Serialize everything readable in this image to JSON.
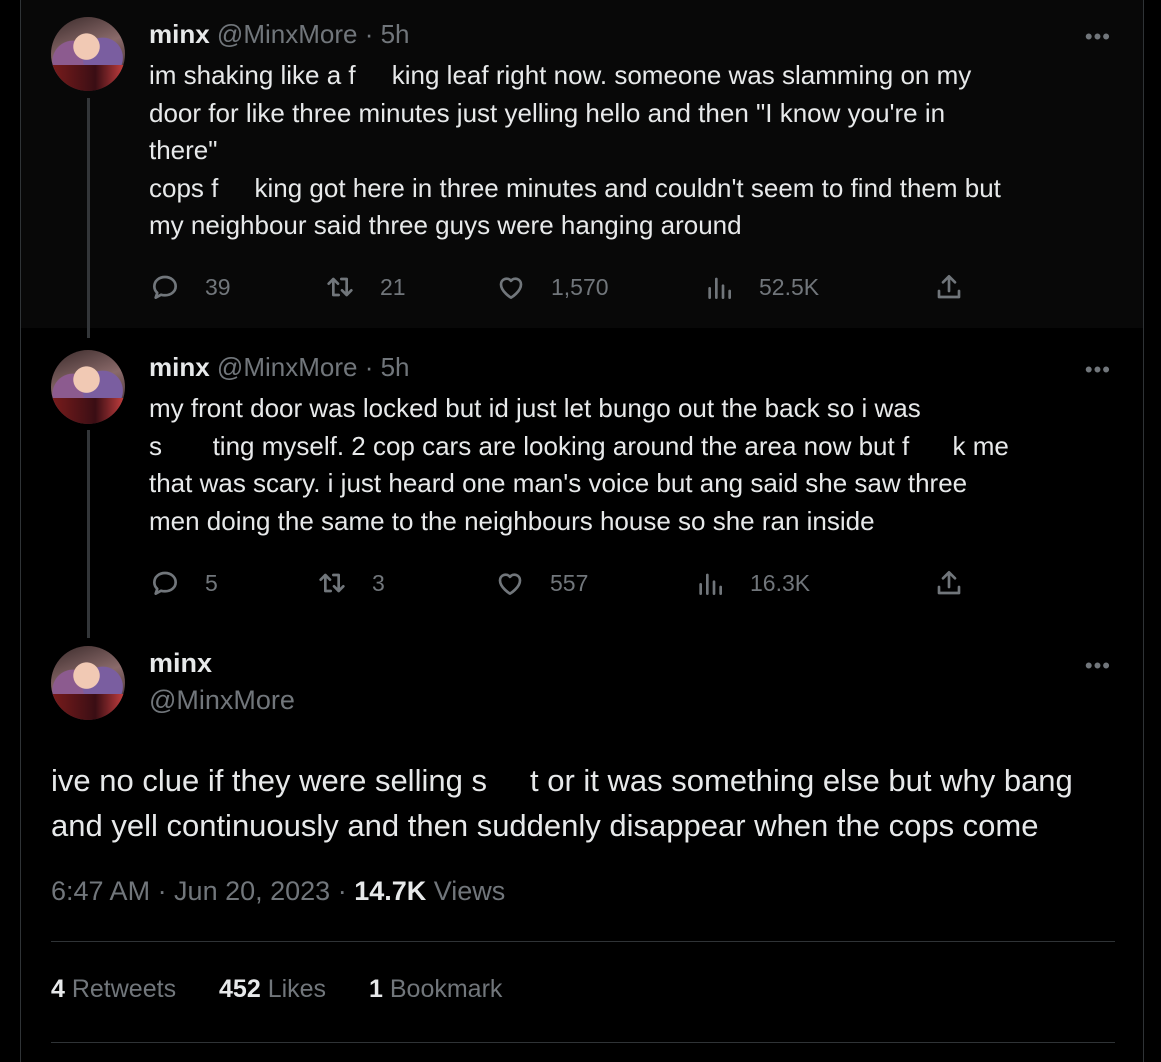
{
  "tweets": [
    {
      "name": "minx",
      "handle": "@MinxMore",
      "sep": "·",
      "time": "5h",
      "more": "•••",
      "text": "im shaking like a f     king leaf right now. someone was slamming on my\ndoor for like three minutes just yelling hello and then \"I know you're in\nthere\"\ncops f     king got here in three minutes and couldn't seem to find them but\nmy neighbour said three guys were hanging around",
      "replies": "39",
      "retweets": "21",
      "likes": "1,570",
      "views": "52.5K"
    },
    {
      "name": "minx",
      "handle": "@MinxMore",
      "sep": "·",
      "time": "5h",
      "more": "•••",
      "text": "my front door was locked but id just let bungo out the back so i was\ns       ting myself. 2 cop cars are looking around the area now but f      k me\nthat was scary. i just heard one man's voice but ang said she saw three\nmen doing the same to the neighbours house so she ran inside",
      "replies": "5",
      "retweets": "3",
      "likes": "557",
      "views": "16.3K"
    }
  ],
  "main": {
    "name": "minx",
    "handle": "@MinxMore",
    "more": "•••",
    "text": "ive no clue if they were selling s     t or it was something else but why bang\nand yell continuously and then suddenly disappear when the cops come",
    "timestamp": "6:47 AM · Jun 20, 2023 · ",
    "views_count": "14.7K",
    "views_label": " Views",
    "retweets_count": "4",
    "retweets_label": " Retweets",
    "likes_count": "452",
    "likes_label": " Likes",
    "bookmarks_count": "1",
    "bookmarks_label": " Bookmark"
  },
  "icons": [
    "reply-icon",
    "retweet-icon",
    "like-icon",
    "views-icon",
    "share-icon",
    "more-icon"
  ],
  "colors": {
    "background": "#000000",
    "text": "#e7e9ea",
    "muted": "#71767b",
    "border": "#2f3336"
  }
}
